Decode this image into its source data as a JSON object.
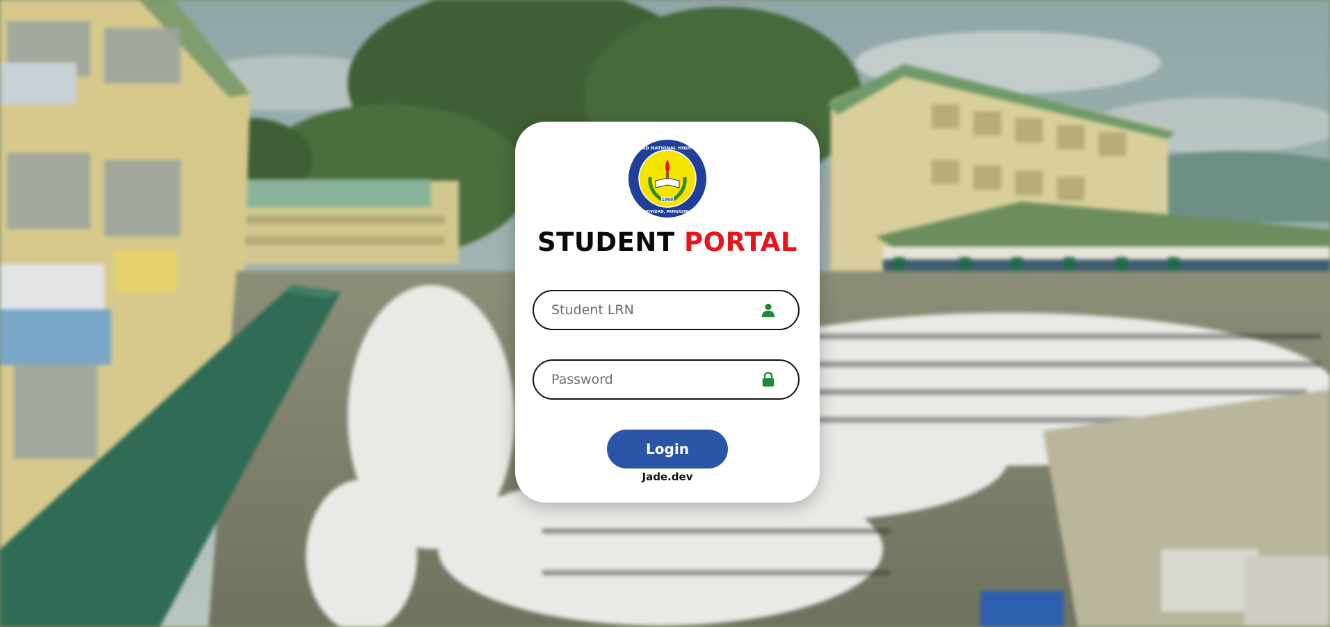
{
  "title": {
    "part1": "STUDENT",
    "part2": "PORTAL"
  },
  "logo": {
    "icon": "school-seal-icon",
    "text_top": "NATIVIDAD NATIONAL HIGH SCHOOL",
    "text_bottom": "NATIVIDAD, PANGASINAN",
    "year": "1968"
  },
  "form": {
    "lrn_placeholder": "Student LRN",
    "lrn_value": "",
    "password_placeholder": "Password",
    "password_value": "",
    "login_label": "Login"
  },
  "footer": {
    "credit": "Jade.dev"
  },
  "icons": {
    "user": "user-icon",
    "lock": "lock-icon"
  },
  "colors": {
    "accent_red": "#e8131b",
    "button_blue": "#2a55a6",
    "icon_green": "#1f8a3a"
  }
}
